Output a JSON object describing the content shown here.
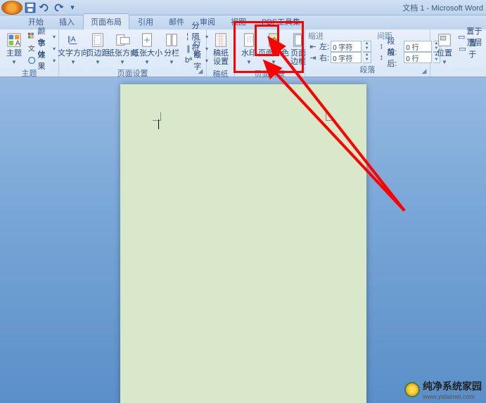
{
  "title": "文档 1 - Microsoft Word",
  "tabs": {
    "t0": "开始",
    "t1": "插入",
    "t2": "页面布局",
    "t3": "引用",
    "t4": "邮件",
    "t5": "审阅",
    "t6": "视图",
    "t7": "PDF工具集"
  },
  "theme": {
    "group": "主题",
    "themes": "主题",
    "colors": "颜色",
    "fonts": "字体",
    "effects": "效果"
  },
  "page_setup": {
    "group": "页面设置",
    "text_dir": "文字方向",
    "margins": "页边距",
    "orientation": "纸张方向",
    "size": "纸张大小",
    "columns": "分栏",
    "breaks": "分隔符",
    "line_num": "行号",
    "hyphen": "断字"
  },
  "gaozhi": {
    "group": "稿纸",
    "label": "稿纸\n设置"
  },
  "page_bg": {
    "group": "页面背景",
    "watermark": "水印",
    "page_color": "页面颜色",
    "page_border": "页面\n边框"
  },
  "paragraph": {
    "group": "段落",
    "indent_hdr": "缩进",
    "spacing_hdr": "间距",
    "left": "左:",
    "right": "右:",
    "before": "段前:",
    "after": "段后:",
    "val_left": "0 字符",
    "val_right": "0 字符",
    "val_before": "0 行",
    "val_after": "0 行"
  },
  "arrange": {
    "group": "",
    "position": "位置",
    "top": "置于顶层",
    "front": "置于"
  },
  "watermark_site": {
    "name": "纯净系统家园",
    "url": "www.yidaimei.com"
  }
}
